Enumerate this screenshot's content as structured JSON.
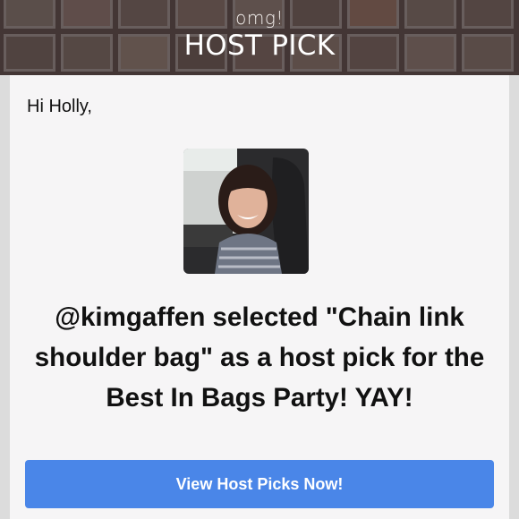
{
  "banner": {
    "subtitle": "omg!",
    "title": "HOST PICK"
  },
  "email": {
    "greeting": "Hi Holly,",
    "message": "@kimgaffen selected \"Chain link shoulder bag\" as a host pick for the Best In Bags Party! YAY!",
    "cta_label": "View Host Picks Now!"
  },
  "colors": {
    "cta_background": "#4a86e8",
    "card_background": "#f6f5f6",
    "banner_overlay": "#5a4a48"
  }
}
